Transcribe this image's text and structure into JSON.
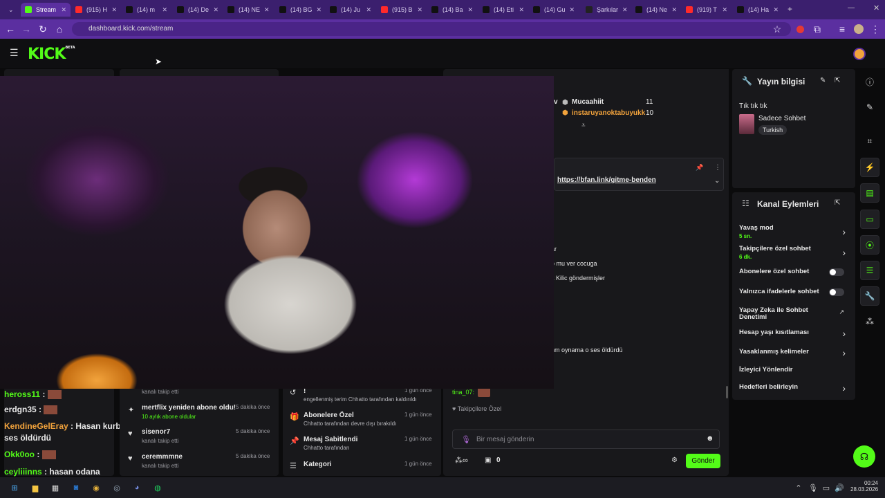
{
  "browser": {
    "tabs": [
      {
        "label": "Stream",
        "icon": "kick-icon",
        "active": true
      },
      {
        "label": "(915) H",
        "icon": "youtube-icon"
      },
      {
        "label": "(14) m",
        "icon": "x-icon"
      },
      {
        "label": "(14) De",
        "icon": "x-icon"
      },
      {
        "label": "(14) NE",
        "icon": "x-icon"
      },
      {
        "label": "(14) BG",
        "icon": "x-icon"
      },
      {
        "label": "(14) Ju",
        "icon": "x-icon"
      },
      {
        "label": "(915) B",
        "icon": "youtube-icon"
      },
      {
        "label": "(14) Ba",
        "icon": "x-icon"
      },
      {
        "label": "(14) Eti",
        "icon": "x-icon"
      },
      {
        "label": "(14) Gu",
        "icon": "x-icon"
      },
      {
        "label": "Şarkılar",
        "icon": "tiktok-icon"
      },
      {
        "label": "(14) Ne",
        "icon": "x-icon"
      },
      {
        "label": "(919) T",
        "icon": "youtube-icon"
      },
      {
        "label": "(14) Ha",
        "icon": "x-icon"
      }
    ],
    "url": "dashboard.kick.com/stream"
  },
  "kick": {
    "logo": "KICK",
    "logo_badge": "BETA"
  },
  "leaderboard": {
    "users": [
      {
        "name": "Mucaahiit",
        "count": "11"
      },
      {
        "name": "instaruyanoktabuyukk",
        "count": "10"
      }
    ]
  },
  "chat": {
    "pinned_link": "https://bfan.link/gitme-benden",
    "fragments": [
      "ar",
      "o mu ver cocuga",
      "k Kilic göndermişler",
      "nm oynama o ses öldürdü"
    ],
    "last_user": "tina_07:",
    "followers_only": "Takipçilere Özel",
    "input_placeholder": "Bir mesaj gönderin",
    "points": "0",
    "send_label": "Gönder",
    "emote_colors": [
      "#53fc18",
      "#53fc18",
      "#53fc18",
      "#53fc18",
      "#53fc18",
      "#53fc18",
      "#53fc18",
      "#f2a33c",
      "#53fc18",
      "#53fc18"
    ]
  },
  "leftchat": {
    "messages": [
      {
        "user": "heross11",
        "text": "",
        "color": "#53fc18"
      },
      {
        "user": "erdgn35",
        "text": "",
        "color": "#e8e8e8"
      },
      {
        "user": "KendineGelEray",
        "text": "Hasan kurban olayım oynama o ses öldürdü",
        "color": "#f2a33c"
      },
      {
        "user": "Okk0oo",
        "text": "",
        "color": "#53fc18"
      },
      {
        "user": "ceyliiinns",
        "text": "hasan odana",
        "color": "#53fc18"
      }
    ]
  },
  "activity": {
    "items": [
      {
        "title": "",
        "sub": "kanalı takip etti",
        "time": ""
      },
      {
        "title": "mertflix yeniden abone oldu!",
        "sub": "10 aylık abone oldular",
        "time": "5 dakika önce"
      },
      {
        "title": "sisenor7",
        "sub": "kanalı takip etti",
        "time": "5 dakika önce"
      },
      {
        "title": "ceremmmne",
        "sub": "kanalı takip etti",
        "time": "5 dakika önce"
      }
    ]
  },
  "modlog": {
    "items": [
      {
        "title": "!",
        "sub": "engellenmiş terim Chhatto tarafından kaldırıldı",
        "time": "1 gün önce"
      },
      {
        "title": "Abonelere Özel",
        "sub": "Chhatto tarafından devre dışı bırakıldı",
        "time": "1 gün önce"
      },
      {
        "title": "Mesaj Sabitlendi",
        "sub": "Chhatto tarafından",
        "time": "1 gün önce"
      },
      {
        "title": "Kategori",
        "sub": "",
        "time": "1 gün önce"
      }
    ]
  },
  "stream_info": {
    "header": "Yayın bilgisi",
    "title": "Tık tık tık",
    "category": "Sadece Sohbet",
    "language": "Turkish"
  },
  "channel_actions": {
    "header": "Kanal Eylemleri",
    "items": [
      {
        "label": "Yavaş mod",
        "value": "5 sn.",
        "control": "chevron"
      },
      {
        "label": "Takipçilere özel sohbet",
        "value": "6 dk.",
        "control": "chevron"
      },
      {
        "label": "Abonelere özel sohbet",
        "value": "",
        "control": "toggle"
      },
      {
        "label": "Yalnızca ifadelerle sohbet",
        "value": "",
        "control": "toggle"
      },
      {
        "label": "Yapay Zeka ile Sohbet Denetimi",
        "value": "",
        "control": "external"
      },
      {
        "label": "Hesap yaşı kısıtlaması",
        "value": "",
        "control": "chevron"
      },
      {
        "label": "Yasaklanmış kelimeler",
        "value": "",
        "control": "chevron"
      },
      {
        "label": "İzleyici Yönlendir",
        "value": "",
        "control": "none"
      },
      {
        "label": "Hedefleri belirleyin",
        "value": "",
        "control": "chevron"
      }
    ]
  },
  "taskbar": {
    "time": "00:24",
    "date": "28.03.2026"
  }
}
